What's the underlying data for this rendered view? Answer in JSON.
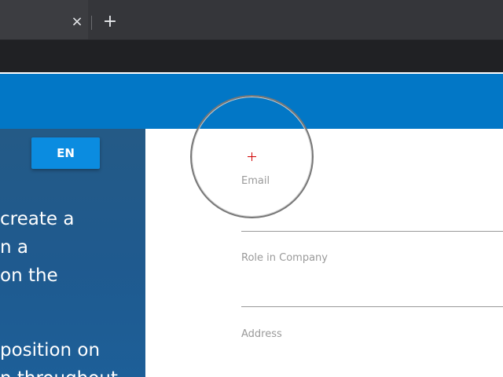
{
  "browser": {
    "tab_close_glyph": "×",
    "new_tab_glyph": "+"
  },
  "sidebar": {
    "language_button": "EN",
    "text_lines": [
      "create a",
      "n a",
      "on the",
      "",
      "position on",
      "n throughout"
    ]
  },
  "form": {
    "fields": [
      {
        "label": "Email",
        "value": ""
      },
      {
        "label": "Role in Company",
        "value": ""
      },
      {
        "label": "Address",
        "value": ""
      }
    ]
  },
  "colors": {
    "header_blue": "#0277c6",
    "sidebar_blue": "#1f5a8f",
    "button_blue": "#0b8ce0",
    "crosshair_red": "#d00000"
  },
  "icons": {
    "close": "close-icon",
    "add": "plus-icon",
    "cursor": "crosshair-icon"
  }
}
